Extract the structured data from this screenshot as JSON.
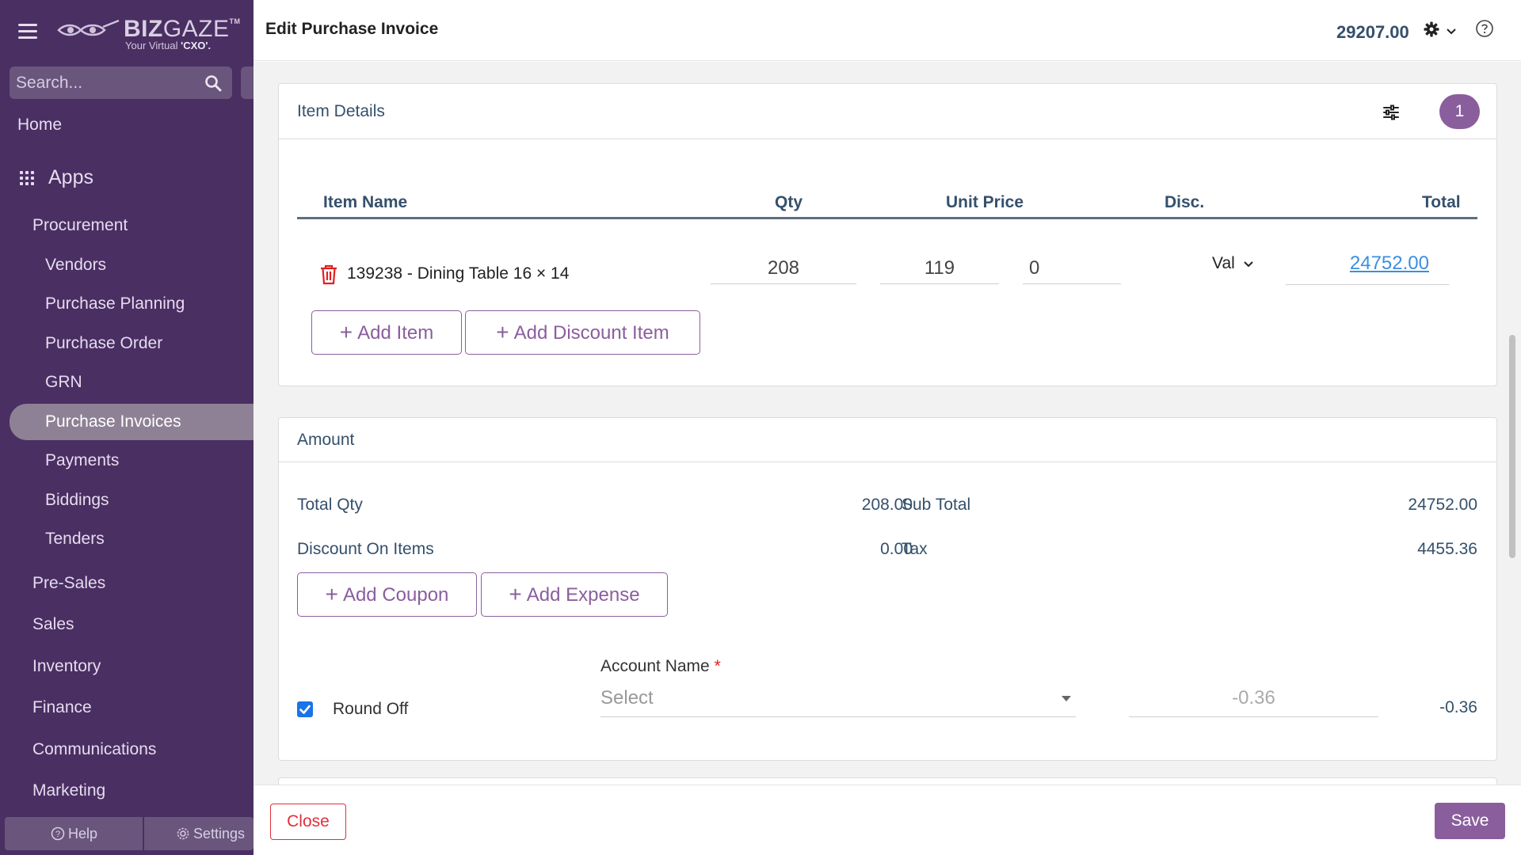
{
  "brand": {
    "name_bold": "BIZ",
    "name_light": "GAZE",
    "trademark": "TM",
    "tagline_prefix": "Your Virtual ",
    "tagline_emphasis": "'CXO'."
  },
  "sidebar": {
    "search_placeholder": "Search...",
    "home": "Home",
    "apps": "Apps",
    "procurement": "Procurement",
    "sub_items": [
      "Vendors",
      "Purchase Planning",
      "Purchase Order",
      "GRN",
      "Purchase Invoices",
      "Payments",
      "Biddings",
      "Tenders"
    ],
    "active_item": "Purchase Invoices",
    "sections": [
      "Pre-Sales",
      "Sales",
      "Inventory",
      "Finance",
      "Communications",
      "Marketing"
    ],
    "help": "Help",
    "settings": "Settings"
  },
  "header": {
    "title": "Edit Purchase Invoice",
    "amount": "29207.00"
  },
  "item_details": {
    "title": "Item Details",
    "count": "1",
    "columns": {
      "item_name": "Item Name",
      "qty": "Qty",
      "unit_price": "Unit Price",
      "disc": "Disc.",
      "total": "Total"
    },
    "row": {
      "name": "139238 - Dining Table 16 × 14",
      "qty": "208",
      "unit_price": "119",
      "disc": "0",
      "disc_type": "Val",
      "total": "24752.00"
    },
    "add_item": "Add Item",
    "add_discount_item": "Add Discount Item"
  },
  "amount": {
    "title": "Amount",
    "total_qty_label": "Total Qty",
    "total_qty": "208.00",
    "discount_label": "Discount On Items",
    "discount": "0.00",
    "sub_total_label": "Sub Total",
    "sub_total": "24752.00",
    "tax_label": "Tax",
    "tax": "4455.36",
    "add_coupon": "Add Coupon",
    "add_expense": "Add Expense",
    "account_name_label": "Account Name",
    "account_placeholder": "Select",
    "round_off_label": "Round Off",
    "round_off_checked": true,
    "round_off_input": "-0.36",
    "round_off_value": "-0.36"
  },
  "footer": {
    "close": "Close",
    "save": "Save"
  },
  "colors": {
    "sidebar_bg": "#4a2f63",
    "accent": "#8a5e9d",
    "danger": "#e0303a",
    "link": "#3a8fe0"
  }
}
